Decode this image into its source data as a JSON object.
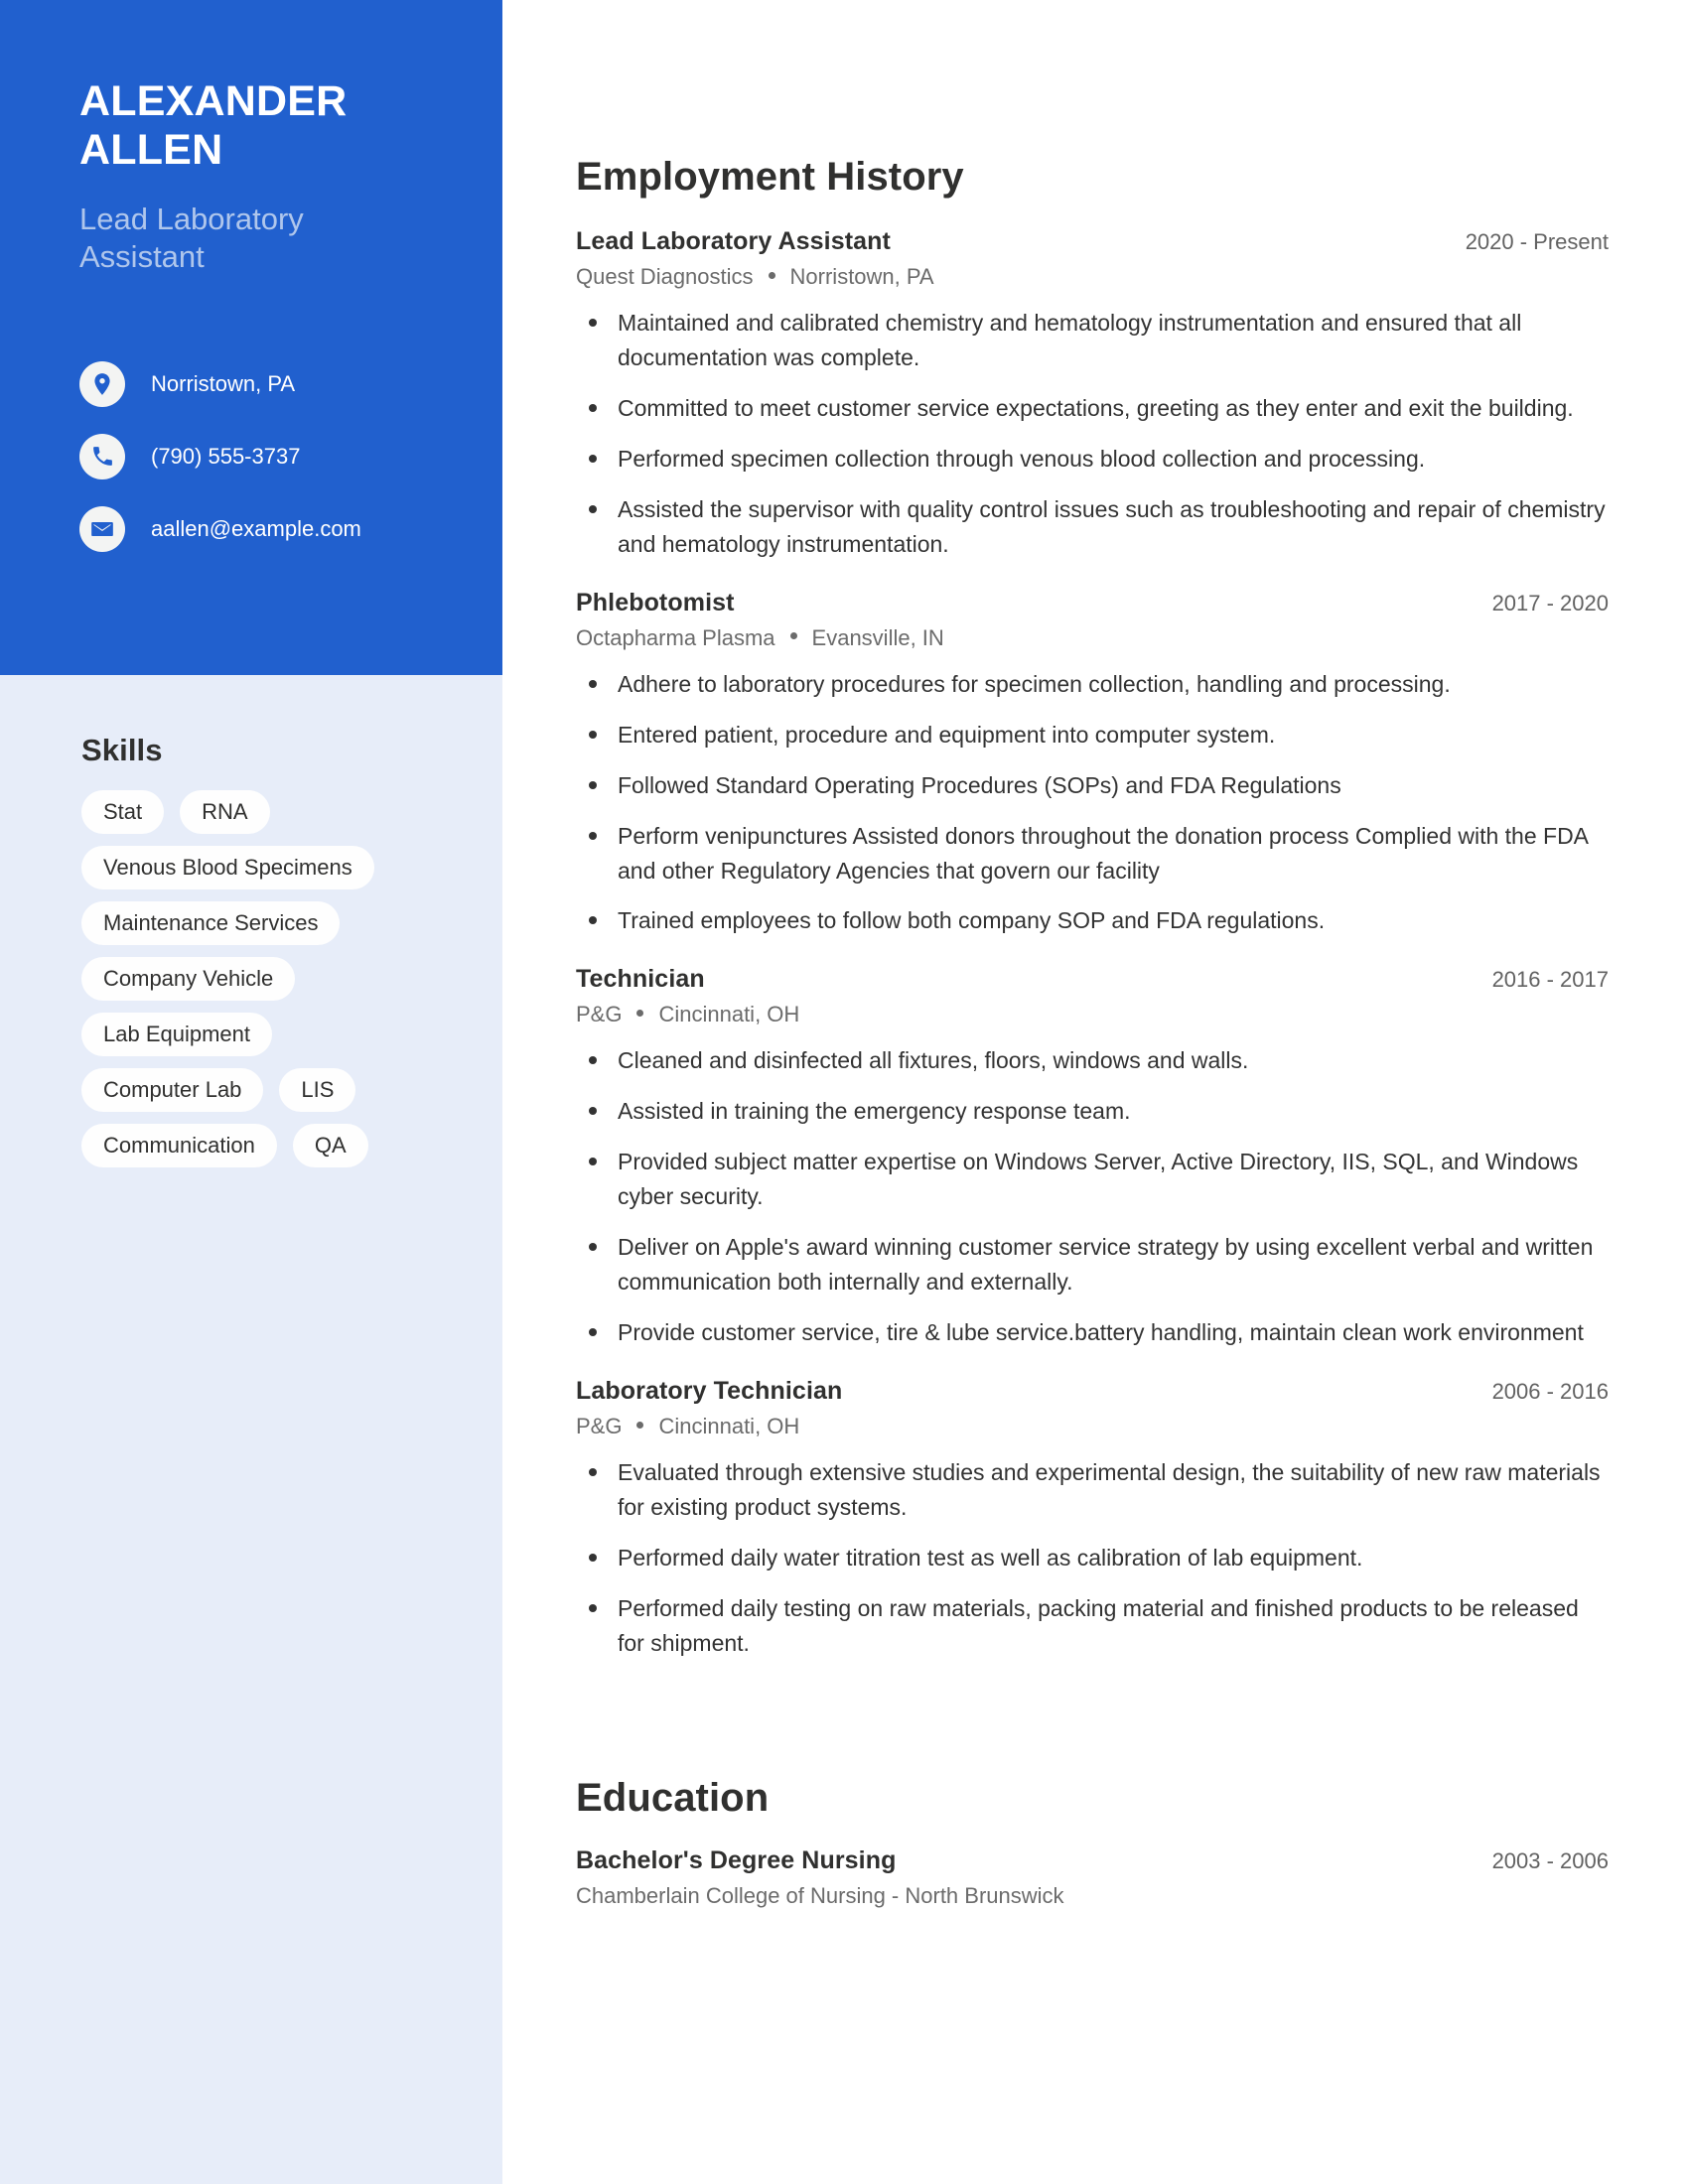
{
  "profile": {
    "name_line1": "ALEXANDER",
    "name_line2": "ALLEN",
    "role_line1": "Lead Laboratory",
    "role_line2": "Assistant"
  },
  "contacts": [
    {
      "icon": "location-pin-icon",
      "text": "Norristown, PA"
    },
    {
      "icon": "phone-icon",
      "text": "(790) 555-3737"
    },
    {
      "icon": "envelope-icon",
      "text": "aallen@example.com"
    }
  ],
  "skills": {
    "title": "Skills",
    "tags": [
      "Stat",
      "RNA",
      "Venous Blood Specimens",
      "Maintenance Services",
      "Company Vehicle",
      "Lab Equipment",
      "Computer Lab",
      "LIS",
      "Communication",
      "QA"
    ]
  },
  "employment": {
    "title": "Employment History",
    "jobs": [
      {
        "title": "Lead Laboratory Assistant",
        "dates": "2020 - Present",
        "company": "Quest Diagnostics",
        "location": "Norristown, PA",
        "bullets": [
          "Maintained and calibrated chemistry and hematology instrumentation and ensured that all documentation was complete.",
          "Committed to meet customer service expectations, greeting as they enter and exit the building.",
          "Performed specimen collection through venous blood collection and processing.",
          "Assisted the supervisor with quality control issues such as troubleshooting and repair of chemistry and hematology instrumentation."
        ]
      },
      {
        "title": "Phlebotomist",
        "dates": "2017 - 2020",
        "company": "Octapharma Plasma",
        "location": "Evansville, IN",
        "bullets": [
          "Adhere to laboratory procedures for specimen collection, handling and processing.",
          "Entered patient, procedure and equipment into computer system.",
          "Followed Standard Operating Procedures (SOPs) and FDA Regulations",
          "Perform venipunctures Assisted donors throughout the donation process Complied with the FDA and other Regulatory Agencies that govern our facility",
          "Trained employees to follow both company SOP and FDA regulations."
        ]
      },
      {
        "title": "Technician",
        "dates": "2016 - 2017",
        "company": "P&G",
        "location": "Cincinnati, OH",
        "bullets": [
          "Cleaned and disinfected all fixtures, floors, windows and walls.",
          "Assisted in training the emergency response team.",
          "Provided subject matter expertise on Windows Server, Active Directory, IIS, SQL, and Windows cyber security.",
          "Deliver on Apple's award winning customer service strategy by using excellent verbal and written communication both internally and externally.",
          "Provide customer service, tire & lube service.battery handling, maintain clean work environment"
        ]
      },
      {
        "title": "Laboratory Technician",
        "dates": "2006 - 2016",
        "company": "P&G",
        "location": "Cincinnati, OH",
        "bullets": [
          "Evaluated through extensive studies and experimental design, the suitability of new raw materials for existing product systems.",
          "Performed daily water titration test as well as calibration of lab equipment.",
          "Performed daily testing on raw materials, packing material and finished products to be released for shipment."
        ]
      }
    ]
  },
  "education": {
    "title": "Education",
    "entries": [
      {
        "degree": "Bachelor's Degree Nursing",
        "dates": "2003 - 2006",
        "school": "Chamberlain College of Nursing - North Brunswick"
      }
    ]
  },
  "colors": {
    "accent_blue": "#2160CE",
    "sidebar_bg": "#E7EDF9",
    "role_text": "#AFC6EC",
    "body_text": "#333333",
    "muted_text": "#6B6B6B"
  }
}
